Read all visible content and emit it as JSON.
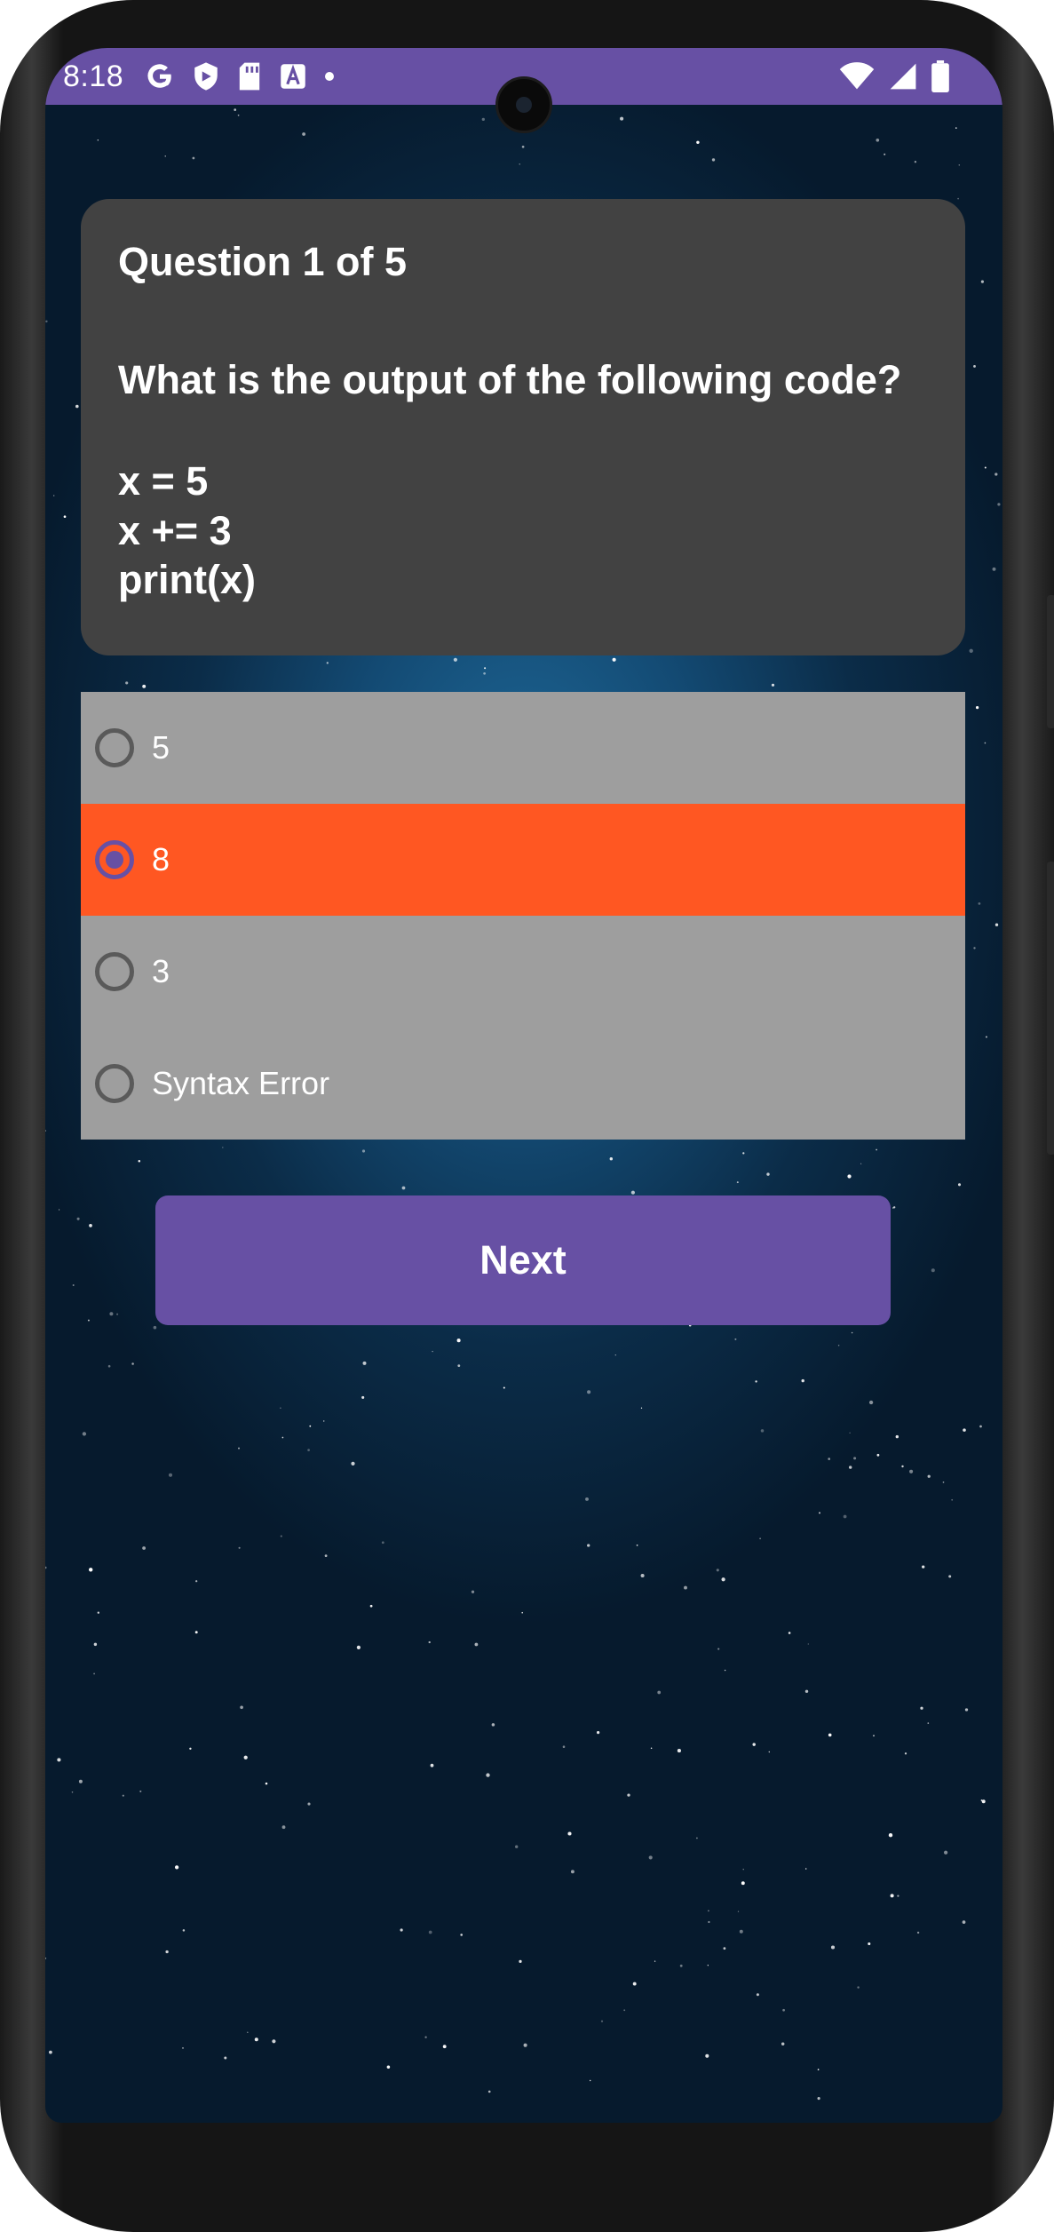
{
  "status_bar": {
    "time": "8:18",
    "notification_icons": [
      "google-icon",
      "shield-icon",
      "sd-card-icon",
      "text-a-icon",
      "dot-icon"
    ],
    "system_icons": [
      "wifi-icon",
      "cell-signal-icon",
      "battery-icon"
    ],
    "color": "#6750a4"
  },
  "quiz": {
    "counter": "Question 1 of 5",
    "question": "What is the output of the following code?",
    "code_lines": [
      "x = 5",
      "x += 3",
      "print(x)"
    ],
    "options": [
      {
        "label": "5",
        "selected": false
      },
      {
        "label": "8",
        "selected": true
      },
      {
        "label": "3",
        "selected": false
      },
      {
        "label": "Syntax Error",
        "selected": false
      }
    ],
    "next_label": "Next"
  },
  "colors": {
    "accent": "#6750a4",
    "selected_option": "#ff5722",
    "option_background": "#9e9e9e",
    "card_background": "#424242"
  }
}
